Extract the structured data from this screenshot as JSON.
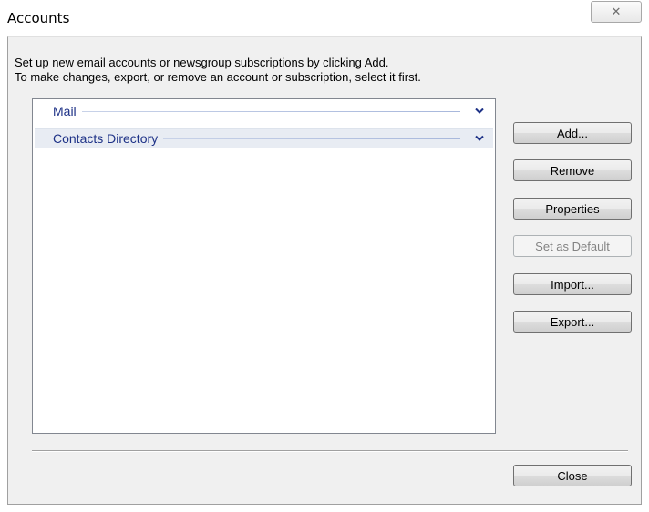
{
  "window": {
    "title": "Accounts",
    "close_glyph": "✕"
  },
  "intro": {
    "line1": "Set up new email accounts or newsgroup subscriptions by clicking Add.",
    "line2": "To make changes, export, or remove an account or subscription, select it first."
  },
  "groups": [
    {
      "label": "Mail",
      "selected": false
    },
    {
      "label": "Contacts Directory",
      "selected": true
    }
  ],
  "buttons": {
    "add": "Add...",
    "remove": "Remove",
    "properties": "Properties",
    "set_default": "Set as Default",
    "import": "Import...",
    "export": "Export...",
    "close": "Close"
  },
  "icons": {
    "chevron": "chevron-down-icon",
    "window_close": "close-icon"
  },
  "colors": {
    "group_text": "#1e3287",
    "dialog_bg": "#f0f0f0"
  }
}
